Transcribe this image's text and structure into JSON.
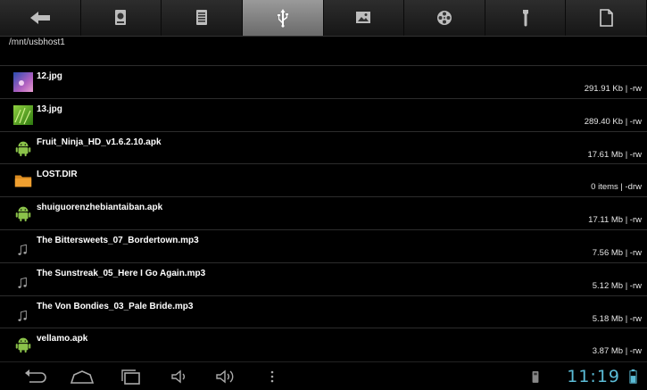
{
  "toolbar": {
    "tabs": [
      {
        "icon": "back-arrow-icon"
      },
      {
        "icon": "sd-card-icon"
      },
      {
        "icon": "internal-storage-icon"
      },
      {
        "icon": "usb-icon",
        "active": true
      },
      {
        "icon": "image-icon"
      },
      {
        "icon": "film-reel-icon"
      },
      {
        "icon": "wrench-icon"
      },
      {
        "icon": "document-icon"
      }
    ]
  },
  "path": "/mnt/usbhost1",
  "files": [
    {
      "name": "12.jpg",
      "info": "291.91 Kb  | -rw",
      "icon": "image-thumbnail-icon"
    },
    {
      "name": "13.jpg",
      "info": "289.40 Kb  | -rw",
      "icon": "image-thumbnail-icon"
    },
    {
      "name": "Fruit_Ninja_HD_v1.6.2.10.apk",
      "info": "17.61 Mb  | -rw",
      "icon": "android-icon"
    },
    {
      "name": "LOST.DIR",
      "info": "0 items | -drw",
      "icon": "folder-icon"
    },
    {
      "name": "shuiguorenzhebiantaiban.apk",
      "info": "17.11 Mb  | -rw",
      "icon": "android-icon"
    },
    {
      "name": "The Bittersweets_07_Bordertown.mp3",
      "info": "7.56 Mb  | -rw",
      "icon": "music-note-icon"
    },
    {
      "name": "The Sunstreak_05_Here I Go Again.mp3",
      "info": "5.12 Mb  | -rw",
      "icon": "music-note-icon"
    },
    {
      "name": "The Von Bondies_03_Pale Bride.mp3",
      "info": "5.18 Mb  | -rw",
      "icon": "music-note-icon"
    },
    {
      "name": "vellamo.apk",
      "info": "3.87 Mb  | -rw",
      "icon": "android-icon"
    }
  ],
  "statusbar": {
    "time": "11:19"
  },
  "colors": {
    "clock": "#5bbcd6",
    "android": "#8bc34a",
    "folder": "#f0a030"
  }
}
